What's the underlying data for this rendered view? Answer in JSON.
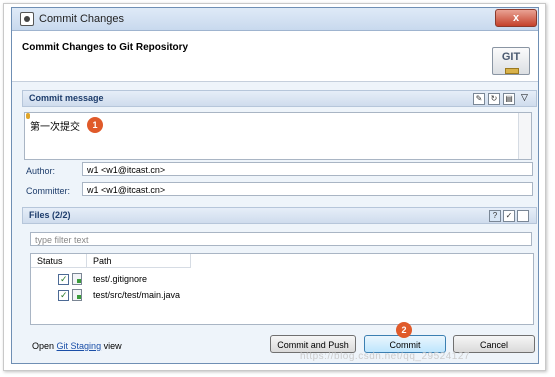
{
  "window": {
    "title": "Commit Changes",
    "close_label": "x"
  },
  "header": {
    "title": "Commit Changes to Git Repository",
    "logo_text": "GIT"
  },
  "commit_message": {
    "section_title": "Commit message",
    "value": "第一次提交",
    "marker": "1"
  },
  "author": {
    "label": "Author:",
    "value": "w1 <w1@itcast.cn>"
  },
  "committer": {
    "label": "Committer:",
    "value": "w1 <w1@itcast.cn>"
  },
  "files": {
    "section_title": "Files (2/2)",
    "filter_placeholder": "type filter text",
    "columns": [
      "Status",
      "Path"
    ],
    "rows": [
      {
        "path": "test/.gitignore"
      },
      {
        "path": "test/src/test/main.java"
      }
    ]
  },
  "footer": {
    "open_prefix": "Open",
    "staging_link": "Git Staging",
    "view_suffix": "view",
    "commit_push_label": "Commit and Push",
    "commit_label": "Commit",
    "commit_marker": "2",
    "cancel_label": "Cancel"
  },
  "watermark": "https://blog.csdn.net/qq_29524127",
  "colors": {
    "accent": "#3c7fb1",
    "marker": "#e05a2a",
    "section_title": "#1d3c6b"
  }
}
